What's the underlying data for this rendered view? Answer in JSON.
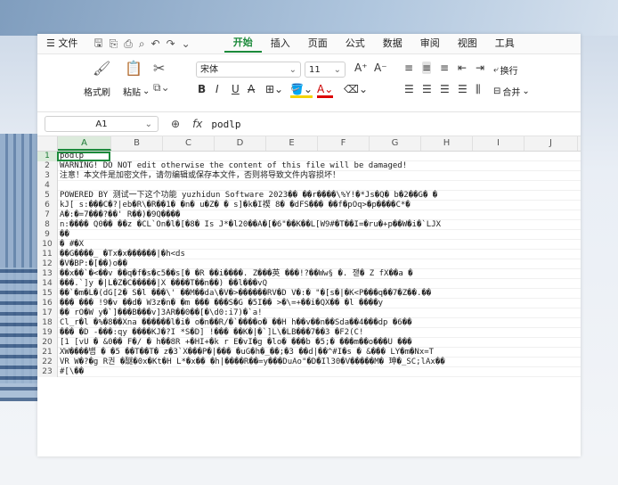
{
  "menu": {
    "file": "文件",
    "tabs": [
      "开始",
      "插入",
      "页面",
      "公式",
      "数据",
      "审阅",
      "视图",
      "工具"
    ],
    "active_tab": "开始"
  },
  "ribbon": {
    "format_painter": "格式刷",
    "paste": "粘贴",
    "font_name": "宋体",
    "font_size": "11",
    "wrap": "换行",
    "merge": "合并"
  },
  "formula_bar": {
    "name_box": "A1",
    "fx": "fx",
    "value": "podlp"
  },
  "columns": [
    "A",
    "B",
    "C",
    "D",
    "E",
    "F",
    "G",
    "H",
    "I",
    "J"
  ],
  "rows": [
    "podlp",
    "WARNING! DO NOT edit otherwise the content of this file will be damaged!",
    "注意！本文件是加密文件，请勿编辑或保存本文件，否则将导致文件内容损坏！",
    "",
    "POWERED BY 测试一下这个功能 yuzhidun Software  2023�� ��r����\\%Y!�*Js�Q� b�2��G� �",
    "kJ[ s:���C�?|eb�R\\�R��1� �n� u�Z� � s]�k�I禊 8� �dFS��� ��f�pOq>�p����C*�",
    "A�:�=7���?��' R��)�9Q����",
    "n:���� Q0�� ��z �CL`On�l�[�8� Is J*�l20��A�[�6\"��K��L[W9#�T��I=�ru�+p��W�i�`LJX",
    "��",
    "� #�X",
    "��G����_ �Tx�x������|�h<ds",
    "�V�BP:�[��)o��",
    "��x��`�<��v ��q�f�s�c5��s[� �R ��i����. Z���英 ���!?��Ww§ �. 잳� Z fX��a �",
    "���.`]y �|L�Z�C�����|X ����T��n��) ��l���vQ",
    "��`�m�L�(dG[2� S�l ���\\' ��M��da\\�V�>������RV�D V�:� \"�[s�|�K<P���q��7�Z��.��",
    "��� ��� !9�v ��d� W3z�n� �m ��� ���S�G �5I�� >�\\=+��i�QX�� �l ����y",
    "�� rO�W y�`]���B���v]3AR��0��[�\\d0:i7)�`a!",
    "Cl_r�l �%�8��Xna ������l�i� o�n��R/�`����o� ��H h��v��n��Sda��4���dp �6��",
    "��� �D -���:qy ����KJ�?I *S�D] !��� ��K�|�`]L\\�LB���7��3 �F2(C!",
    "[1 [vU � &0�� F�/ � h��8R +�HI+�k r E�vI�g �lo� ���b �5;� ���m��o���U ���",
    "XW����뱀 � �5 ��T��T� z�3`X���P�|��� �uG�h�_��;�3 ��d|��^#I�s � &��� LY�m�Nx=T",
    "VR W�?�g R권 �醚�0x�Kt�H L*�x�� �h|����R��=y���DuAo\"�D�Il30�V�����M� 珅�_SC;lAx��",
    "#[\\��"
  ]
}
